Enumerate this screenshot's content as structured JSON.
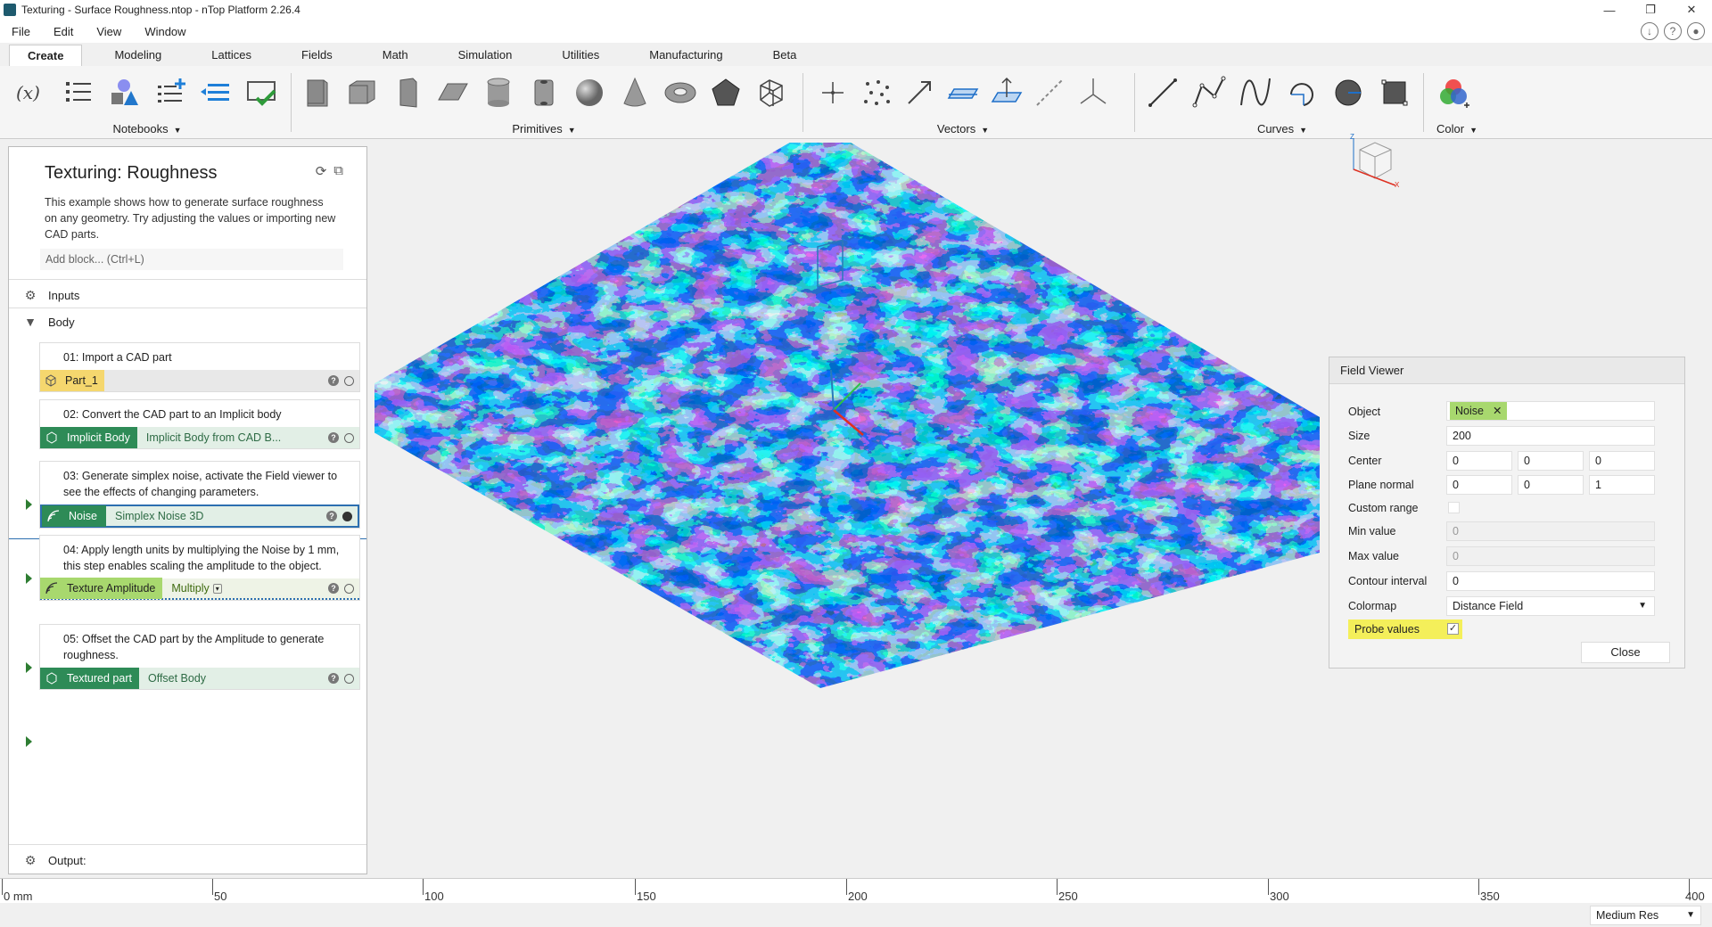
{
  "window": {
    "title": "Texturing - Surface Roughness.ntop - nTop Platform 2.26.4"
  },
  "menu": [
    "File",
    "Edit",
    "View",
    "Window"
  ],
  "tabs": [
    "Create",
    "Modeling",
    "Lattices",
    "Fields",
    "Math",
    "Simulation",
    "Utilities",
    "Manufacturing",
    "Beta"
  ],
  "ribbon": {
    "notebooks": "Notebooks",
    "primitives": "Primitives",
    "vectors": "Vectors",
    "curves": "Curves",
    "color": "Color"
  },
  "notebook": {
    "title": "Texturing: Roughness",
    "description": "This example shows how to generate surface roughness on any geometry. Try adjusting the values or importing new CAD parts.",
    "add_block_placeholder": "Add block... (Ctrl+L)",
    "inputs_label": "Inputs",
    "body_label": "Body",
    "output_label": "Output:",
    "blocks": [
      {
        "desc": "01: Import a CAD part",
        "name": "Part_1",
        "type": ""
      },
      {
        "desc": "02: Convert the CAD part to an Implicit body",
        "name": "Implicit Body",
        "type": "Implicit Body from CAD B..."
      },
      {
        "desc": "03: Generate simplex noise, activate the Field viewer to see the effects of changing parameters.",
        "name": "Noise",
        "type": "Simplex Noise 3D"
      },
      {
        "desc": "04: Apply length units by multiplying the Noise by 1 mm, this step enables scaling the amplitude to the object.",
        "name": "Texture Amplitude",
        "type": "Multiply"
      },
      {
        "desc": "05: Offset the CAD part by the Amplitude to generate roughness.",
        "name": "Textured part",
        "type": "Offset Body"
      }
    ]
  },
  "field_viewer": {
    "title": "Field Viewer",
    "labels": {
      "object": "Object",
      "size": "Size",
      "center": "Center",
      "plane_normal": "Plane normal",
      "custom_range": "Custom range",
      "min_value": "Min value",
      "max_value": "Max value",
      "contour_interval": "Contour interval",
      "colormap": "Colormap",
      "probe_values": "Probe values"
    },
    "object": "Noise",
    "size": "200",
    "center": [
      "0",
      "0",
      "0"
    ],
    "plane_normal": [
      "0",
      "0",
      "1"
    ],
    "min_value": "0",
    "max_value": "0",
    "contour_interval": "0",
    "colormap": "Distance Field",
    "probe_checked": "✓",
    "close": "Close"
  },
  "ruler": {
    "labels": [
      "0 mm",
      "50",
      "100",
      "150",
      "200",
      "250",
      "300",
      "350",
      "400"
    ]
  },
  "status": {
    "resolution": "Medium Res"
  },
  "colors": {
    "noise_low": "#00e0e0",
    "noise_mid": "#7a1fd6",
    "noise_high": "#e020a0",
    "accent_green": "#2e8b57"
  }
}
